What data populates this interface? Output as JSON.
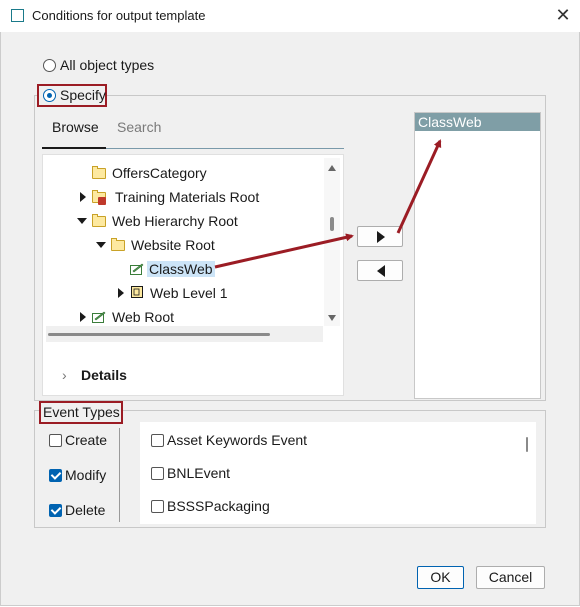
{
  "window": {
    "title": "Conditions for output template",
    "close_glyph": "✕"
  },
  "scope": {
    "all_label": "All object types",
    "specify_label": "Specify"
  },
  "tabs": [
    {
      "label": "Browse"
    },
    {
      "label": "Search"
    }
  ],
  "tree": {
    "items": [
      {
        "label": "OffersCategory",
        "icon": "folder-icon",
        "expander": "none"
      },
      {
        "label": "Training Materials Root",
        "icon": "folder-icon",
        "expander": "collapsed"
      },
      {
        "label": "Web Hierarchy Root",
        "icon": "folder-icon",
        "expander": "expanded"
      },
      {
        "label": "Website Root",
        "icon": "folder-icon",
        "expander": "expanded"
      },
      {
        "label": "ClassWeb",
        "icon": "class-icon",
        "expander": "none",
        "selected": true
      },
      {
        "label": "Web Level 1",
        "icon": "page-icon",
        "expander": "collapsed"
      },
      {
        "label": "Web Root",
        "icon": "class-icon",
        "expander": "collapsed"
      }
    ]
  },
  "details": {
    "label": "Details"
  },
  "selected_list": {
    "items": [
      "ClassWeb"
    ]
  },
  "event_types": {
    "label": "Event Types",
    "actions": [
      {
        "label": "Create",
        "checked": false
      },
      {
        "label": "Modify",
        "checked": true
      },
      {
        "label": "Delete",
        "checked": true
      }
    ],
    "events": [
      {
        "label": "Asset Keywords Event",
        "checked": false
      },
      {
        "label": "BNLEvent",
        "checked": false
      },
      {
        "label": "BSSSPackaging",
        "checked": false
      }
    ]
  },
  "footer": {
    "ok_label": "OK",
    "cancel_label": "Cancel"
  },
  "colors": {
    "accent": "#0063b1",
    "annotation_red": "#9b1c24",
    "list_header": "#7f9ea6",
    "selection": "#cce4f7"
  }
}
